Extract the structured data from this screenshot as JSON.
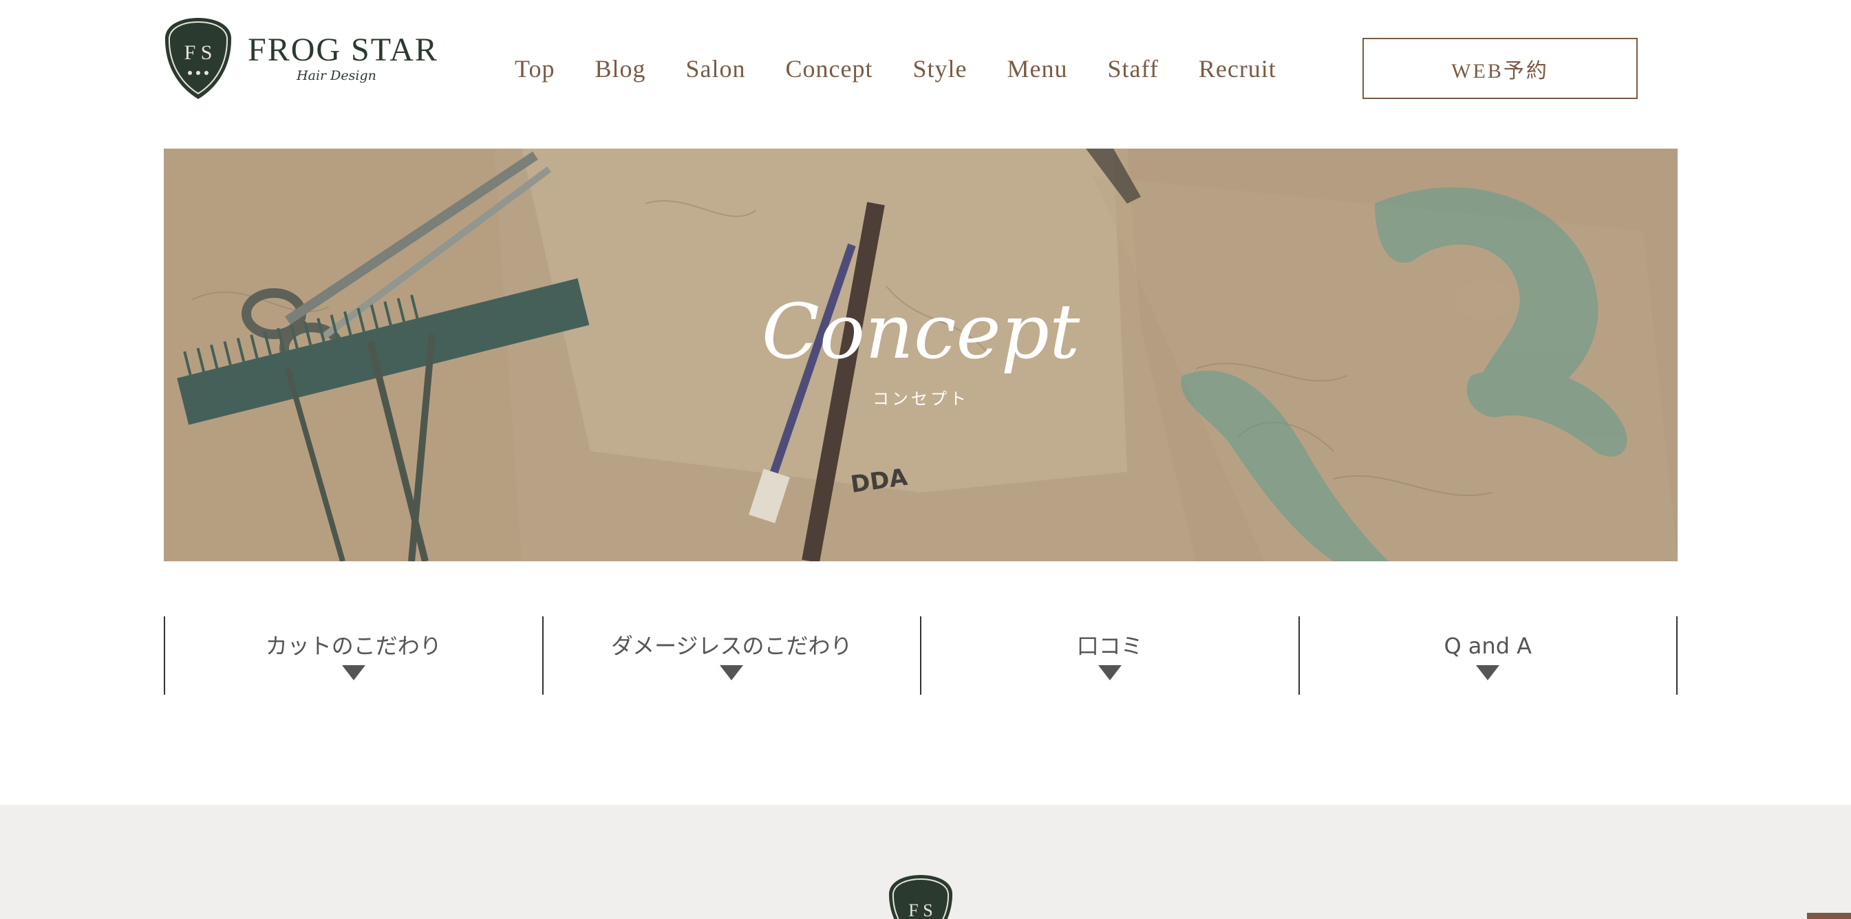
{
  "header": {
    "brand": "FROG STAR",
    "brand_sub": "Hair Design",
    "crest_letters": "FS",
    "nav": [
      "Top",
      "Blog",
      "Salon",
      "Concept",
      "Style",
      "Menu",
      "Staff",
      "Recruit"
    ],
    "web_button": "WEB予約"
  },
  "hero": {
    "title": "Concept",
    "subtitle": "コンセプト"
  },
  "subnav": {
    "items": [
      "カットのこだわり",
      "ダメージレスのこだわり",
      "口コミ",
      "Q and A"
    ]
  },
  "colors": {
    "accent": "#7a5a44",
    "brand_green": "#2b3a2e",
    "hero_tint": "#b9a386",
    "footer_bg": "#f0efed"
  }
}
